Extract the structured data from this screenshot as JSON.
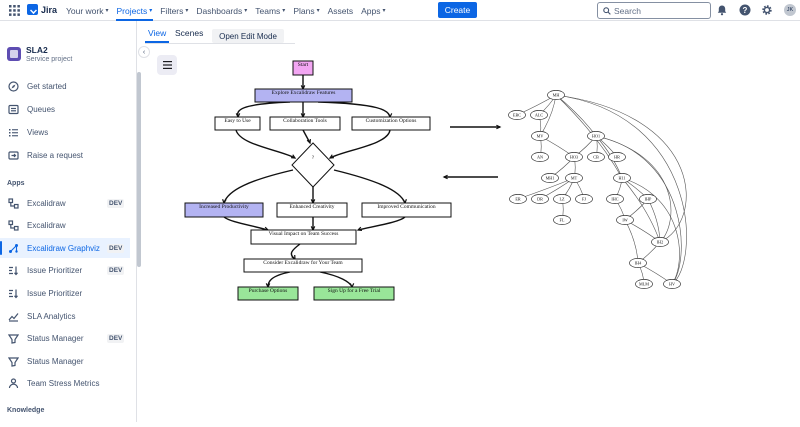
{
  "topnav": {
    "logo_text": "Jira",
    "menu": [
      {
        "label": "Your work",
        "active": false
      },
      {
        "label": "Projects",
        "active": true
      },
      {
        "label": "Filters",
        "active": false
      },
      {
        "label": "Dashboards",
        "active": false
      },
      {
        "label": "Teams",
        "active": false
      },
      {
        "label": "Plans",
        "active": false
      },
      {
        "label": "Assets",
        "active": false,
        "no_chevron": true
      },
      {
        "label": "Apps",
        "active": false
      }
    ],
    "create_label": "Create",
    "search_placeholder": "Search",
    "avatar_initials": "JK",
    "accent": "#0c66e4"
  },
  "sidebar": {
    "project_name": "SLA2",
    "project_type": "Service project",
    "items": [
      {
        "label": "Get started",
        "icon": "compass-icon"
      },
      {
        "label": "Queues",
        "icon": "queues-icon"
      },
      {
        "label": "Views",
        "icon": "list-icon"
      },
      {
        "label": "Raise a request",
        "icon": "raise-request-icon"
      }
    ],
    "apps_heading": "Apps",
    "apps": [
      {
        "label": "Excalidraw",
        "badge": "DEV",
        "icon": "app-diagram-icon"
      },
      {
        "label": "Excalidraw",
        "badge": "",
        "icon": "app-diagram-icon"
      },
      {
        "label": "Excalidraw Graphviz",
        "badge": "DEV",
        "icon": "graphviz-icon",
        "selected": true
      },
      {
        "label": "Issue Prioritizer",
        "badge": "DEV",
        "icon": "prioritizer-icon"
      },
      {
        "label": "Issue Prioritizer",
        "badge": "",
        "icon": "prioritizer-icon"
      },
      {
        "label": "SLA Analytics",
        "badge": "",
        "icon": "analytics-icon"
      },
      {
        "label": "Status Manager",
        "badge": "DEV",
        "icon": "status-icon"
      },
      {
        "label": "Status Manager",
        "badge": "",
        "icon": "status-icon"
      },
      {
        "label": "Team Stress Metrics",
        "badge": "",
        "icon": "team-icon"
      }
    ],
    "knowledge_heading": "Knowledge"
  },
  "main": {
    "tabs": [
      {
        "label": "View",
        "active": true
      },
      {
        "label": "Scenes",
        "active": false
      }
    ],
    "edit_button": "Open Edit Mode"
  },
  "diagram": {
    "flowchart": {
      "start": "Start",
      "explore": "Explore Excalidraw Features",
      "branches": [
        "Easy to Use",
        "Collaboration Tools",
        "Customization Options"
      ],
      "decision": "?",
      "outcomes": [
        "Increased Productivity",
        "Enhanced Creativity",
        "Improved Communication"
      ],
      "visual_impact": "Visual Impact on Team Success",
      "consider": "Consider Excalidraw for Your Team",
      "end_options": [
        "Purchase Options",
        "Sign Up for a Free Trial"
      ],
      "colors": {
        "start": "#f2a6f2",
        "explore": "#b3b3f2",
        "increased": "#b3b3f2",
        "end": "#99e699"
      }
    },
    "graph_nodes": [
      "MH",
      "ERC",
      "ALC",
      "MV",
      "HO1",
      "AN",
      "HO3",
      "CB",
      "HR",
      "MH1",
      "MT",
      "H11",
      "ER",
      "DR",
      "LZ",
      "FJ",
      "FL",
      "IHC",
      "IHP",
      "IW",
      "IH2",
      "IH4",
      "MLM",
      "HV"
    ]
  }
}
